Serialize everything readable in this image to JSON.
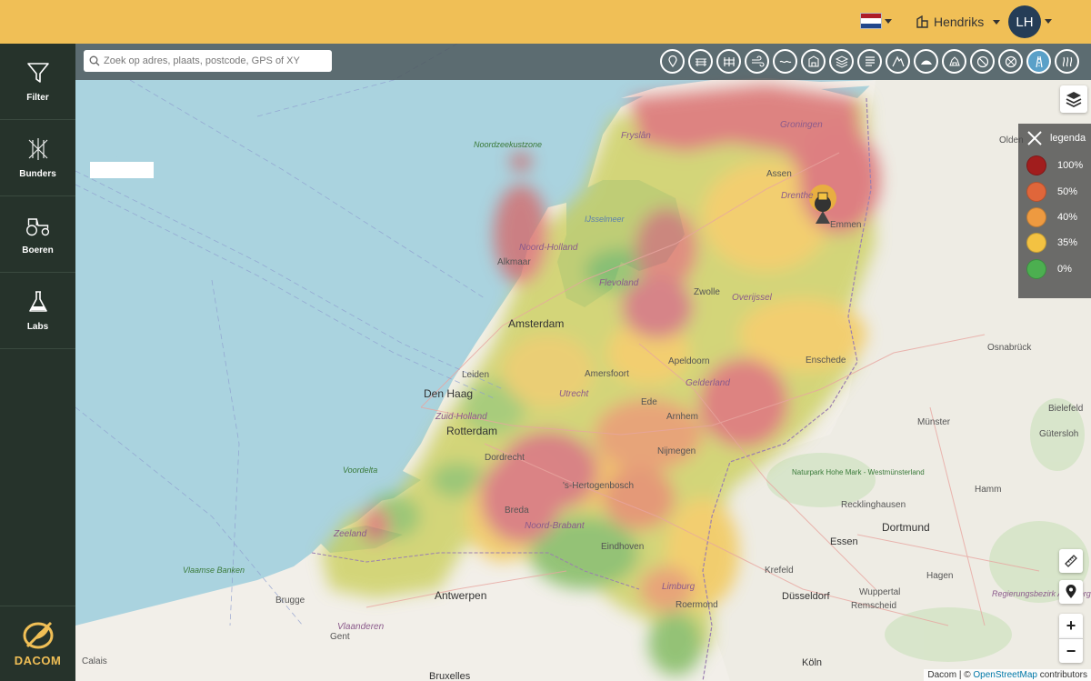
{
  "topbar": {
    "flag_colors": [
      "#ae1c28",
      "#ffffff",
      "#21468b"
    ],
    "user_name": "Hendriks",
    "avatar_initials": "LH"
  },
  "sidebar": {
    "items": [
      {
        "label": "Filter",
        "icon": "filter-icon"
      },
      {
        "label": "Bunders",
        "icon": "bunders-icon"
      },
      {
        "label": "Boeren",
        "icon": "tractor-icon"
      },
      {
        "label": "Labs",
        "icon": "flask-icon"
      }
    ],
    "logo_text": "DACOM"
  },
  "search": {
    "placeholder": "Zoek op adres, plaats, postcode, GPS of XY"
  },
  "layer_buttons": [
    "location-layer-icon",
    "field-layer-icon",
    "fence-layer-icon",
    "wind-layer-icon",
    "water-layer-icon",
    "building-layer-icon",
    "soil-layer-icon",
    "lines-layer-icon",
    "mountain-layer-icon",
    "hill-layer-icon",
    "animals-layer-icon",
    "no-entry-layer-icon",
    "prohibited-layer-icon",
    "road-layer-icon",
    "heat-layer-icon"
  ],
  "active_layer_index": 13,
  "legend": {
    "title": "legenda",
    "items": [
      {
        "label": "100%",
        "color": "#a11d1d"
      },
      {
        "label": "50%",
        "color": "#e0663a"
      },
      {
        "label": "40%",
        "color": "#ee9a40"
      },
      {
        "label": "35%",
        "color": "#f3c242"
      },
      {
        "label": "0%",
        "color": "#4caf50"
      }
    ]
  },
  "map_labels": {
    "noordzeekustzone": "Noordzeekustzone",
    "friesland": "Fryslân",
    "groningen": "Groningen",
    "oldenburg": "Olden",
    "assen": "Assen",
    "drenthe": "Drenthe",
    "emmen": "Emmen",
    "ijsselmeer": "IJsselmeer",
    "noord_holland": "Noord-Holland",
    "alkmaar": "Alkmaar",
    "flevoland": "Flevoland",
    "zwolle": "Zwolle",
    "overijssel": "Overijssel",
    "amsterdam": "Amsterdam",
    "leiden": "Leiden",
    "den_haag": "Den Haag",
    "amersfoort": "Amersfoort",
    "apeldoorn": "Apeldoorn",
    "utrecht": "Utrecht",
    "gelderland": "Gelderland",
    "enschede": "Enschede",
    "osnabruck": "Osnabrück",
    "zuid_holland": "Zuid-Holland",
    "rotterdam": "Rotterdam",
    "ede": "Ede",
    "arnhem": "Arnhem",
    "munster": "Münster",
    "bielefeld": "Bielefeld",
    "gutersloh": "Gütersloh",
    "voordelta": "Voordelta",
    "dordrecht": "Dordrecht",
    "nijmegen": "Nijmegen",
    "hertogenbosch": "'s-Hertogenbosch",
    "naturpark": "Naturpark Hohe Mark - Westmünsterland",
    "hamm": "Hamm",
    "breda": "Breda",
    "noord_brabant": "Noord-Brabant",
    "recklinghausen": "Recklinghausen",
    "zeeland": "Zeeland",
    "dortmund": "Dortmund",
    "eindhoven": "Eindhoven",
    "essen": "Essen",
    "vlaamse_banken": "Vlaamse Banken",
    "krefeld": "Krefeld",
    "limburg": "Limburg",
    "hagen": "Hagen",
    "brugge": "Brugge",
    "antwerpen": "Antwerpen",
    "roermond": "Roermond",
    "dusseldorf": "Düsseldorf",
    "wuppertal": "Wuppertal",
    "remscheid": "Remscheid",
    "regierungsbezirk": "Regierungsbezirk Arnsberg",
    "vlaanderen": "Vlaanderen",
    "gent": "Gent",
    "calais": "Calais",
    "bruxelles": "Bruxelles",
    "koln": "Köln"
  },
  "attribution": {
    "prefix": "Dacom | ©",
    "link": "OpenStreetMap",
    "suffix": "contributors"
  }
}
